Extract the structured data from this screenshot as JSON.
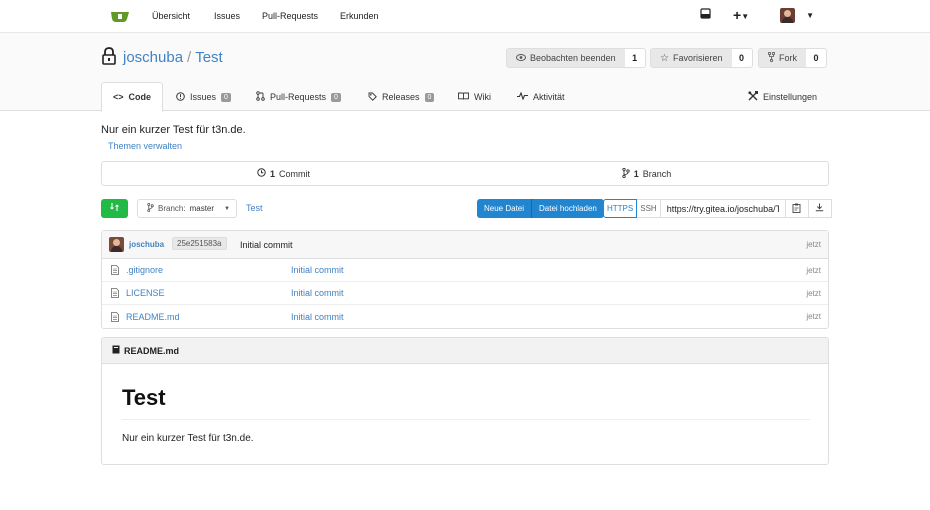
{
  "nav": {
    "items": [
      "Übersicht",
      "Issues",
      "Pull-Requests",
      "Erkunden"
    ],
    "plus": "+"
  },
  "repo": {
    "owner": "joschuba",
    "separator": "/",
    "name": "Test",
    "watch": {
      "label": "Beobachten beenden",
      "count": "1"
    },
    "star": {
      "label": "Favorisieren",
      "count": "0"
    },
    "fork": {
      "label": "Fork",
      "count": "0"
    }
  },
  "tabs": {
    "code": "Code",
    "issues": {
      "label": "Issues",
      "count": "0"
    },
    "pulls": {
      "label": "Pull-Requests",
      "count": "0"
    },
    "releases": {
      "label": "Releases",
      "count": "0"
    },
    "wiki": "Wiki",
    "activity": "Aktivität",
    "settings": "Einstellungen"
  },
  "description": "Nur ein kurzer Test für t3n.de.",
  "topics_link": "Themen verwalten",
  "stats": {
    "commits_num": "1",
    "commits_label": "Commit",
    "branches_num": "1",
    "branches_label": "Branch"
  },
  "toolbar": {
    "branch_label": "Branch:",
    "branch_name": "master",
    "breadcrumb": "Test",
    "new_file": "Neue Datei",
    "upload_file": "Datei hochladen",
    "https": "HTTPS",
    "ssh": "SSH",
    "clone_url": "https://try.gitea.io/joschuba/Test.git"
  },
  "latest_commit": {
    "author": "joschuba",
    "sha": "25e251583a",
    "message": "Initial commit",
    "age": "jetzt"
  },
  "files": [
    {
      "name": ".gitignore",
      "commit": "Initial commit",
      "age": "jetzt"
    },
    {
      "name": "LICENSE",
      "commit": "Initial commit",
      "age": "jetzt"
    },
    {
      "name": "README.md",
      "commit": "Initial commit",
      "age": "jetzt"
    }
  ],
  "readme": {
    "filename": "README.md",
    "heading": "Test",
    "body": "Nur ein kurzer Test für t3n.de."
  },
  "colors": {
    "brand_green": "#609926",
    "link": "#4183c4",
    "primary": "#2185d0",
    "success": "#21ba45"
  }
}
